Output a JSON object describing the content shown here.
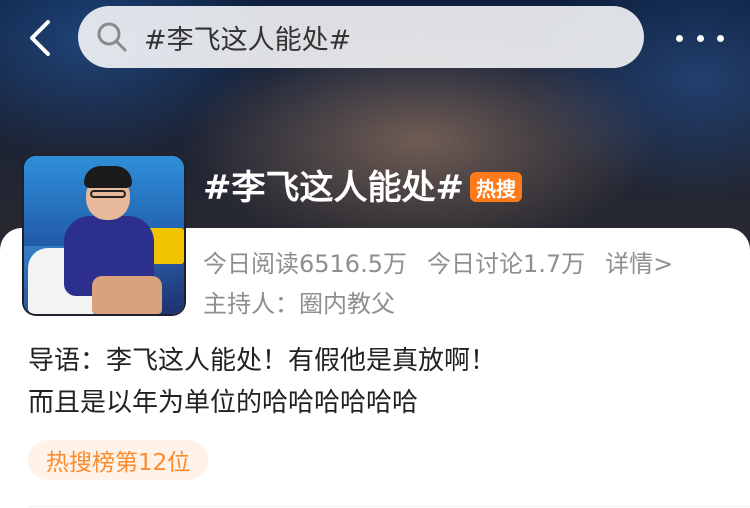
{
  "header": {
    "search_text": "#李飞这人能处#"
  },
  "topic": {
    "title": "#李飞这人能处#",
    "hot_badge": "热搜",
    "reads": "今日阅读6516.5万",
    "discussions": "今日讨论1.7万",
    "details_link": "详情>",
    "host": "主持人：圈内教父",
    "intro_line1": "导语：李飞这人能处！有假他是真放啊！",
    "intro_line2": "而且是以年为单位的哈哈哈哈哈哈",
    "rank_chip": "热搜榜第12位"
  },
  "colors": {
    "accent_orange": "#ff7a1a",
    "chip_bg": "#fff2e8",
    "muted_text": "#8e8e93"
  }
}
